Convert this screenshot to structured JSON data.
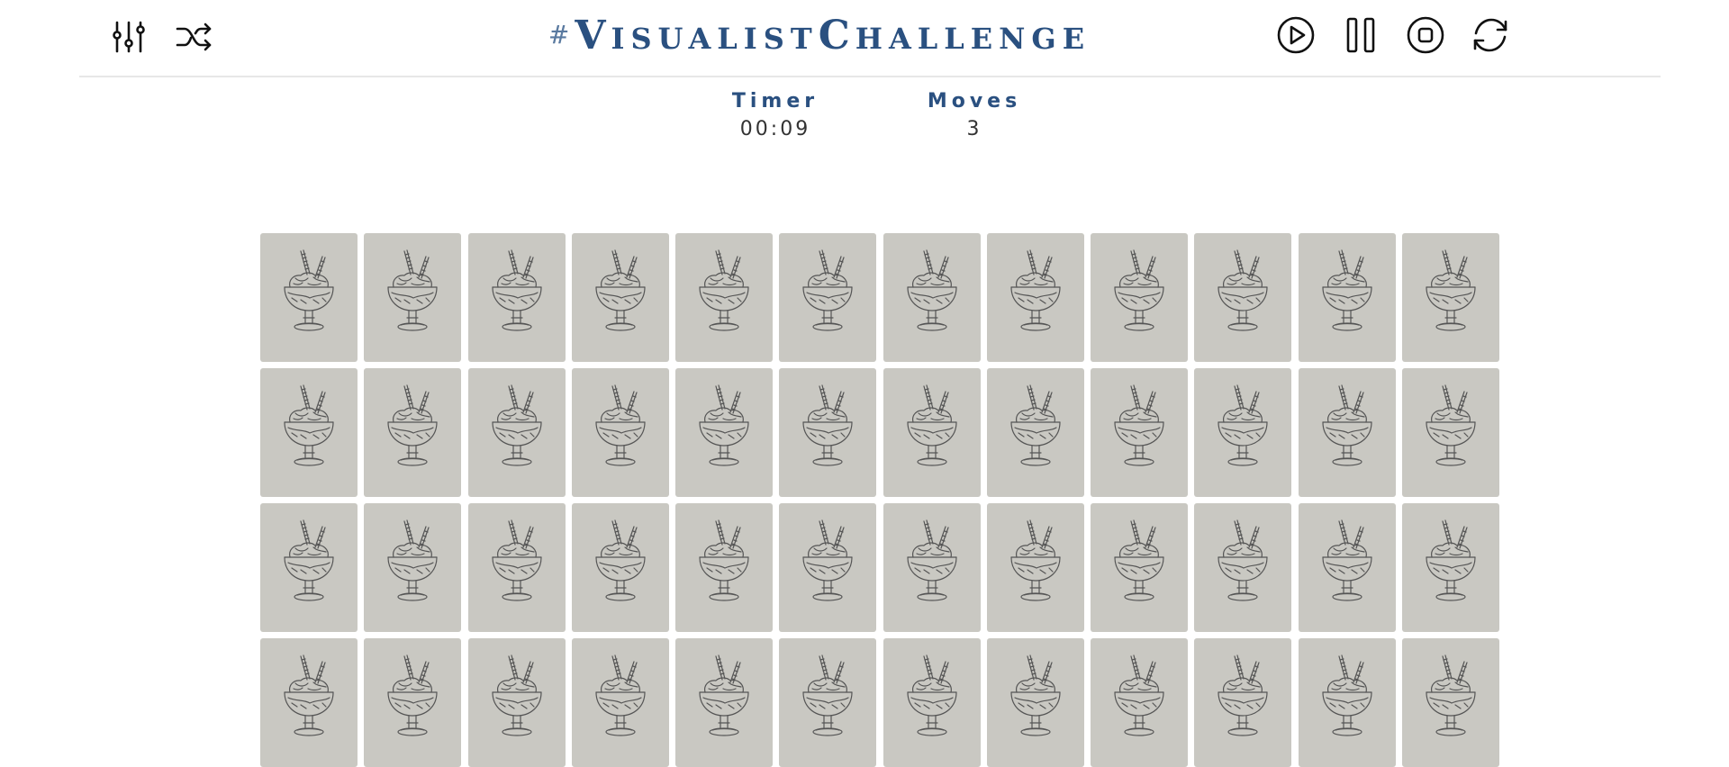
{
  "header": {
    "title_hash": "#",
    "title_v": "V",
    "title_isualist": "ISUALIST",
    "title_c": "C",
    "title_hallenge": "HALLENGE"
  },
  "controls": {
    "left": [
      {
        "name": "settings-sliders-icon"
      },
      {
        "name": "shuffle-icon"
      }
    ],
    "right": [
      {
        "name": "play-icon"
      },
      {
        "name": "pause-icon"
      },
      {
        "name": "stop-icon"
      },
      {
        "name": "restart-icon"
      }
    ]
  },
  "stats": {
    "timer_label": "Timer",
    "timer_value": "00:09",
    "moves_label": "Moves",
    "moves_value": "3"
  },
  "board": {
    "columns": 12,
    "visible_rows": 4,
    "card_back_icon": "ice-cream-sundae-icon",
    "card_color": "#c9c8c2"
  },
  "colors": {
    "accent": "#2a5080",
    "divider": "#e7e7e7"
  }
}
